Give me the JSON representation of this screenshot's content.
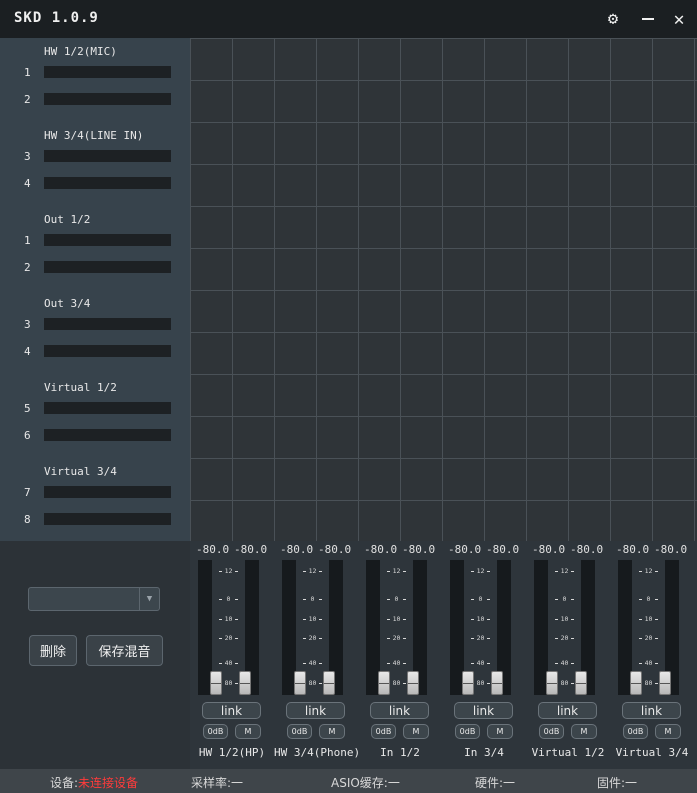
{
  "app": {
    "title": "SKD 1.0.9"
  },
  "channel_groups": [
    {
      "name": "HW 1/2(MIC)",
      "channels": [
        "1",
        "2"
      ]
    },
    {
      "name": "HW 3/4(LINE IN)",
      "channels": [
        "3",
        "4"
      ]
    },
    {
      "name": "Out 1/2",
      "channels": [
        "1",
        "2"
      ]
    },
    {
      "name": "Out 3/4",
      "channels": [
        "3",
        "4"
      ]
    },
    {
      "name": "Virtual 1/2",
      "channels": [
        "5",
        "6"
      ]
    },
    {
      "name": "Virtual 3/4",
      "channels": [
        "7",
        "8"
      ]
    }
  ],
  "controls": {
    "preset_value": "",
    "delete_label": "删除",
    "save_label": "保存混音"
  },
  "fader_scale": [
    "12",
    "0",
    "10",
    "20",
    "40",
    "80"
  ],
  "strips": [
    {
      "name": "HW 1/2(HP)",
      "left_db": "-80.0",
      "right_db": "-80.0",
      "link_label": "link",
      "zero_label": "0dB",
      "mute_label": "M"
    },
    {
      "name": "HW 3/4(Phone)",
      "left_db": "-80.0",
      "right_db": "-80.0",
      "link_label": "link",
      "zero_label": "0dB",
      "mute_label": "M"
    },
    {
      "name": "In 1/2",
      "left_db": "-80.0",
      "right_db": "-80.0",
      "link_label": "link",
      "zero_label": "0dB",
      "mute_label": "M"
    },
    {
      "name": "In 3/4",
      "left_db": "-80.0",
      "right_db": "-80.0",
      "link_label": "link",
      "zero_label": "0dB",
      "mute_label": "M"
    },
    {
      "name": "Virtual 1/2",
      "left_db": "-80.0",
      "right_db": "-80.0",
      "link_label": "link",
      "zero_label": "0dB",
      "mute_label": "M"
    },
    {
      "name": "Virtual 3/4",
      "left_db": "-80.0",
      "right_db": "-80.0",
      "link_label": "link",
      "zero_label": "0dB",
      "mute_label": "M"
    }
  ],
  "status": {
    "device_label": "设备:",
    "device_value": "未连接设备",
    "sample_rate": "采样率:一",
    "asio_buffer": "ASIO缓存:一",
    "hardware": "硬件:一",
    "firmware": "固件:一"
  },
  "colors": {
    "warning": "#ff3b3b",
    "grid_line": "#4a5157",
    "panel": "#37434c"
  }
}
